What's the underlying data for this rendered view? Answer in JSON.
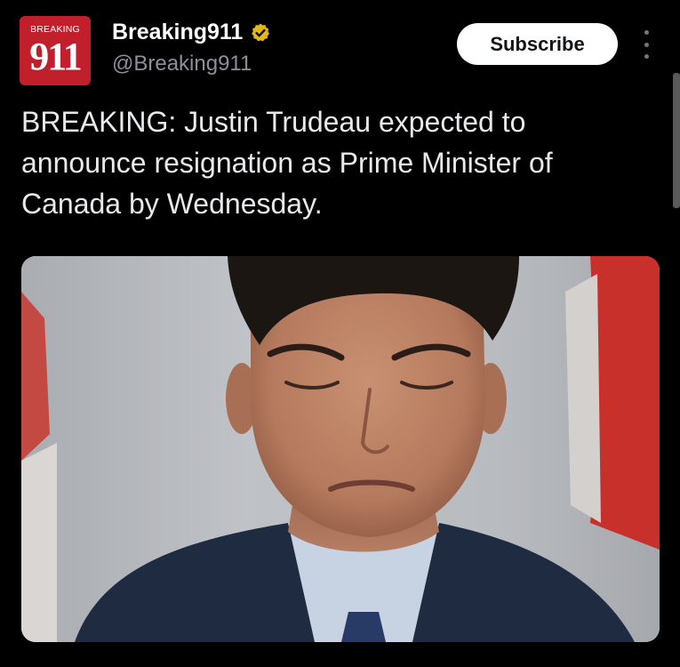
{
  "account": {
    "display_name": "Breaking911",
    "handle": "@Breaking911",
    "verified_badge": "gold-verified-badge-icon",
    "avatar": {
      "logo_top": "BREAKING",
      "logo_number": "911",
      "color": "#c21f2c"
    }
  },
  "actions": {
    "subscribe_label": "Subscribe",
    "more_icon": "more-options-icon"
  },
  "tweet": {
    "text": "BREAKING: Justin Trudeau expected to announce resignation as Prime Minister of Canada by Wednesday."
  },
  "media": {
    "description_icon": "news-photo"
  },
  "colors": {
    "background": "#000000",
    "primary_text": "#e7e9ea",
    "secondary_text": "#8b9197",
    "badge_gold": "#e2b719"
  }
}
